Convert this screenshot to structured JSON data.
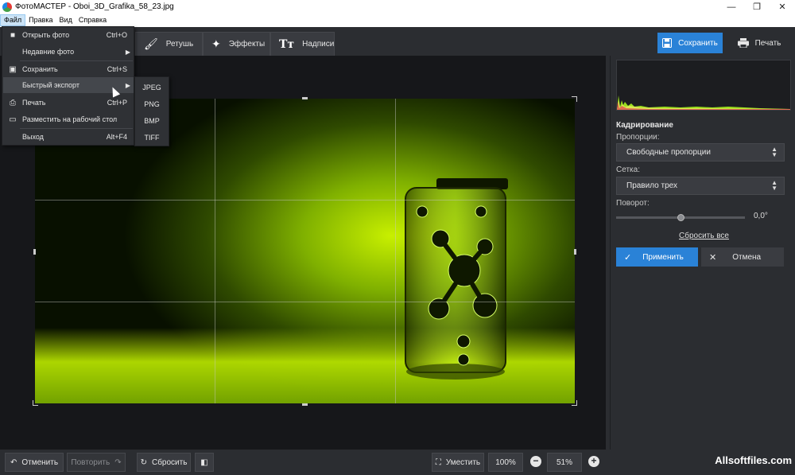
{
  "window": {
    "title": "ФотоМАСТЕР - Oboi_3D_Grafika_58_23.jpg",
    "minimize": "—",
    "maximize": "❐",
    "close": "✕"
  },
  "menubar": [
    "Файл",
    "Правка",
    "Вид",
    "Справка"
  ],
  "toolbar": {
    "tabs": [
      {
        "label": "Ретушь",
        "icon": "brush-icon"
      },
      {
        "label": "Эффекты",
        "icon": "magic-wand-icon"
      },
      {
        "label": "Надписи",
        "icon": "text-icon"
      }
    ],
    "save_label": "Сохранить",
    "print_label": "Печать"
  },
  "file_menu": {
    "items": [
      {
        "label": "Открыть фото",
        "shortcut": "Ctrl+O",
        "icon": "folder-icon"
      },
      {
        "label": "Недавние фото",
        "shortcut": "",
        "submenu": true
      },
      {
        "label": "Сохранить",
        "shortcut": "Ctrl+S",
        "icon": "save-icon"
      },
      {
        "label": "Быстрый экспорт",
        "shortcut": "",
        "submenu": true
      },
      {
        "label": "Печать",
        "shortcut": "Ctrl+P",
        "icon": "printer-icon"
      },
      {
        "label": "Разместить на рабочий стол",
        "shortcut": "",
        "icon": "monitor-icon"
      },
      {
        "label": "Выход",
        "shortcut": "Alt+F4"
      }
    ],
    "export_submenu": [
      "JPEG",
      "PNG",
      "BMP",
      "TIFF"
    ]
  },
  "panel": {
    "heading": "Кадрирование",
    "proportions_label": "Пропорции:",
    "proportions_value": "Свободные пропорции",
    "grid_label": "Сетка:",
    "grid_value": "Правило трех",
    "rotation_label": "Поворот:",
    "rotation_value": "0,0°",
    "rotation_fraction": 0.5,
    "reset_all": "Сбросить все",
    "apply_label": "Применить",
    "cancel_label": "Отмена"
  },
  "bottombar": {
    "undo_label": "Отменить",
    "redo_label": "Повторить",
    "reset_label": "Сбросить",
    "fit_label": "Уместить",
    "zoom_100": "100%",
    "zoom_value": "51%",
    "watermark": "Allsoftfiles.com"
  },
  "colors": {
    "accent": "#2a82d7",
    "background": "#2b2d31",
    "canvas": "#16171a"
  }
}
